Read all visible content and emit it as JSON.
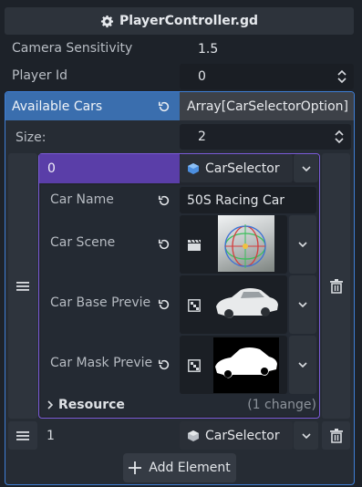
{
  "header": {
    "title": "PlayerController.gd",
    "icon": "gear-icon"
  },
  "properties": {
    "camera_sensitivity": {
      "label": "Camera Sensitivity",
      "value": "1.5"
    },
    "player_id": {
      "label": "Player Id",
      "value": "0"
    }
  },
  "available_cars": {
    "label": "Available Cars",
    "value": "Array[CarSelectorOption]",
    "size_label": "Size:",
    "size_value": "2",
    "accent_color": "#3a6eae"
  },
  "elements": [
    {
      "index": "0",
      "type": "CarSelector",
      "fields": {
        "car_name": {
          "label": "Car Name",
          "value": "50S Racing Car"
        },
        "car_scene": {
          "label": "Car Scene"
        },
        "car_base_preview": {
          "label": "Car Base Previe"
        },
        "car_mask_preview": {
          "label": "Car Mask Previe"
        }
      },
      "resource": {
        "label": "Resource",
        "changes": "(1 change)"
      },
      "accent_color": "#5a3ea8"
    },
    {
      "index": "1",
      "type": "CarSelector"
    }
  ],
  "add_element": {
    "label": "Add Element"
  }
}
